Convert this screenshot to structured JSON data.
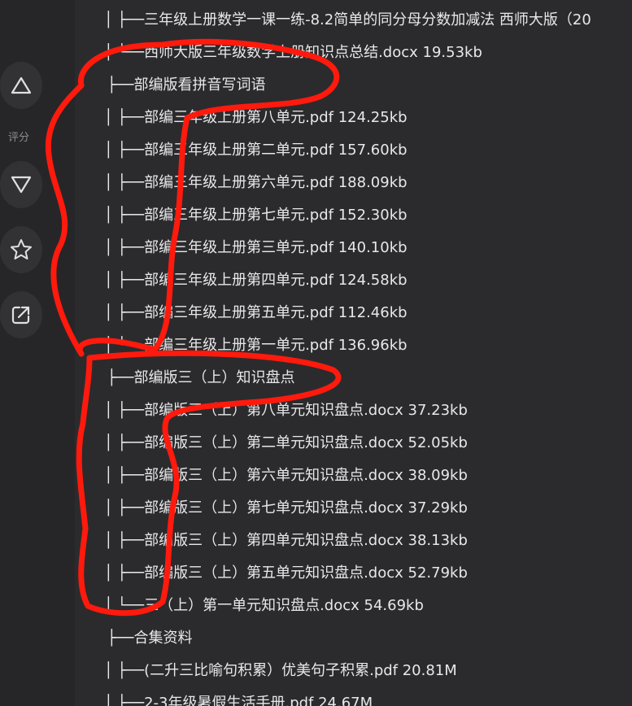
{
  "sidebar": {
    "rating_label": "评分",
    "buttons": [
      {
        "name": "upvote-button",
        "icon": "triangle-up-icon"
      },
      {
        "name": "downvote-button",
        "icon": "triangle-down-icon"
      },
      {
        "name": "favorite-button",
        "icon": "star-icon"
      },
      {
        "name": "share-button",
        "icon": "share-icon"
      }
    ]
  },
  "colors": {
    "background": "#2b2b2d",
    "sidebar": "#262628",
    "button": "#323235",
    "text": "#e8e8ea",
    "annotation": "#ff1a0d"
  },
  "file_tree": [
    {
      "prefix": "│ ├──",
      "text": "三年级上册数学一课一练-8.2简单的同分母分数加减法 西师大版（20"
    },
    {
      "prefix": "│ └──",
      "text": "西师大版三年级数学上册知识点总结.docx 19.53kb"
    },
    {
      "prefix": "├──",
      "text": "部编版看拼音写词语"
    },
    {
      "prefix": "│ ├──",
      "text": "部编三年级上册第八单元.pdf 124.25kb"
    },
    {
      "prefix": "│ ├──",
      "text": "部编三年级上册第二单元.pdf 157.60kb"
    },
    {
      "prefix": "│ ├──",
      "text": "部编三年级上册第六单元.pdf 188.09kb"
    },
    {
      "prefix": "│ ├──",
      "text": "部编三年级上册第七单元.pdf 152.30kb"
    },
    {
      "prefix": "│ ├──",
      "text": "部编三年级上册第三单元.pdf 140.10kb"
    },
    {
      "prefix": "│ ├──",
      "text": "部编三年级上册第四单元.pdf 124.58kb"
    },
    {
      "prefix": "│ ├──",
      "text": "部编三年级上册第五单元.pdf 112.46kb"
    },
    {
      "prefix": "│ └──",
      "text": "部编三年级上册第一单元.pdf 136.96kb"
    },
    {
      "prefix": "├──",
      "text": "部编版三（上）知识盘点"
    },
    {
      "prefix": "│ ├──",
      "text": "部编版三（上）第八单元知识盘点.docx 37.23kb"
    },
    {
      "prefix": "│ ├──",
      "text": "部编版三（上）第二单元知识盘点.docx 52.05kb"
    },
    {
      "prefix": "│ ├──",
      "text": "部编版三（上）第六单元知识盘点.docx 38.09kb"
    },
    {
      "prefix": "│ ├──",
      "text": "部编版三（上）第七单元知识盘点.docx 37.29kb"
    },
    {
      "prefix": "│ ├──",
      "text": "部编版三（上）第四单元知识盘点.docx 38.13kb"
    },
    {
      "prefix": "│ ├──",
      "text": "部编版三（上）第五单元知识盘点.docx 52.79kb"
    },
    {
      "prefix": "│ └──",
      "text": "三（上）第一单元知识盘点.docx 54.69kb"
    },
    {
      "prefix": "├──",
      "text": "合集资料"
    },
    {
      "prefix": "│ ├──",
      "text": "(二升三比喻句积累）优美句子积累.pdf 20.81M"
    },
    {
      "prefix": "│ ├──",
      "text": "2-3年级暑假生活手册.pdf 24.67M"
    }
  ]
}
